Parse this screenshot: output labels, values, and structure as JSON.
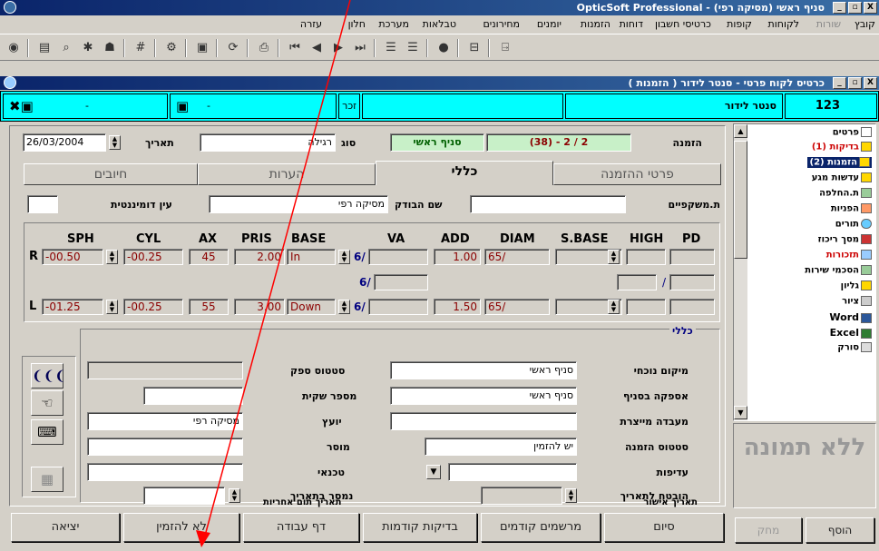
{
  "app": {
    "title": "OpticSoft Professional - סניף ראשי (מסיקה רפי)",
    "win_buttons": [
      "_",
      "▫",
      "X"
    ]
  },
  "menu": [
    "קובץ",
    "שורות",
    "לקוחות",
    "קופות",
    "כרטיסי חשבון",
    "דוחות",
    "טבלאות",
    "מערכת",
    "חלון",
    "עזרה",
    "מחירונים",
    "יומנים",
    "הזמנות"
  ],
  "toolbar_icons": [
    "door-icon",
    "lens-icon",
    "align-right-icon",
    "align-left-icon",
    "last-icon",
    "next-icon",
    "prev-icon",
    "first-icon",
    "print-icon",
    "refresh-icon",
    "save-icon",
    "find-icon",
    "grid-icon",
    "tools-icon",
    "person-icon",
    "preview-icon",
    "settings-icon",
    "exit-icon"
  ],
  "subwindow": {
    "title": "כרטיס לקוח פרטי - סנטר לידור ( הזמנות )"
  },
  "customer": {
    "id": "123",
    "name": "סנטר לידור",
    "gender": "זכר",
    "dash1": "-",
    "dash2": "-"
  },
  "order": {
    "label": "הזמנה",
    "number": "(38) - 2 / 2",
    "branch": "סניף ראשי",
    "type_label": "סוג",
    "type": "רגילה",
    "date_label": "תאריך",
    "date": "26/03/2004"
  },
  "tabs": {
    "t1": "פרטי ההזמנה",
    "t2": "כללי",
    "t3": "הערות",
    "t4": "חיובים"
  },
  "info": {
    "glasses_label": "ת.משקפיים",
    "checker_label": "שם הבודק",
    "checker": "מסיקה רפי",
    "dom_eye_label": "עין דומיננטית"
  },
  "rx": {
    "headers": [
      "SPH",
      "CYL",
      "AX",
      "PRIS",
      "BASE",
      "VA",
      "ADD",
      "DIAM",
      "S.BASE",
      "HIGH",
      "PD"
    ],
    "R": {
      "label": "R",
      "sph": "-00.50",
      "cyl": "-00.25",
      "ax": "45",
      "pris": "2.00",
      "base": "In",
      "va": "6/",
      "add": "1.00",
      "diam": "65/"
    },
    "mid": {
      "va": "6/",
      "pd": "/"
    },
    "L": {
      "label": "L",
      "sph": "-01.25",
      "cyl": "-00.25",
      "ax": "55",
      "pris": "3.00",
      "base": "Down",
      "va": "6/",
      "add": "1.50",
      "diam": "65/"
    }
  },
  "general": {
    "title": "כללי",
    "current_loc_label": "מיקום נוכחי",
    "current_loc": "סניף ראשי",
    "supply_branch_label": "אספקה בסניף",
    "supply_branch": "סניף ראשי",
    "lab_label": "מעבדה מייצרת",
    "order_status_label": "סטטוס הזמנה",
    "order_status": "יש להזמין",
    "priority_label": "עדיפות",
    "promised_label": "הובטח לתאריך",
    "approval_label": "תאריך אישור",
    "supplier_status_label": "סטטוס ספק",
    "bag_label": "מספר שקית",
    "advisor_label": "יועץ",
    "advisor": "מסיקה רפי",
    "handed_label": "מוסר",
    "tech_label": "טכנאי",
    "delivered_label": "נמסר בתאריך",
    "warranty_label": "תאריך תום אחריות"
  },
  "tree": [
    "פרטים",
    "בדיקות (1)",
    "הזמנות (2)",
    "עדשות מגע",
    "ת.החלפה",
    "הפניות",
    "תורים",
    "מסך ריכוז",
    "תזכורות",
    "הסכמי שירות",
    "גליון",
    "ציור",
    "Word",
    "Excel",
    "סורק"
  ],
  "no_image": "ללא תמונה",
  "buttons": {
    "exit": "יציאה",
    "order_now": "לא להזמין",
    "work_page": "דף עבודה",
    "prev_tests": "בדיקות קודמות",
    "prev_rx": "מרשמים קודמים",
    "finish": "סיום",
    "delete": "מחק",
    "add": "הוסף"
  },
  "colors": {
    "title": "#0a246a",
    "cyan": "#00ffff",
    "rx_text": "#8b0000",
    "tree_red": "#cc0000",
    "arrow": "#ff0000"
  }
}
